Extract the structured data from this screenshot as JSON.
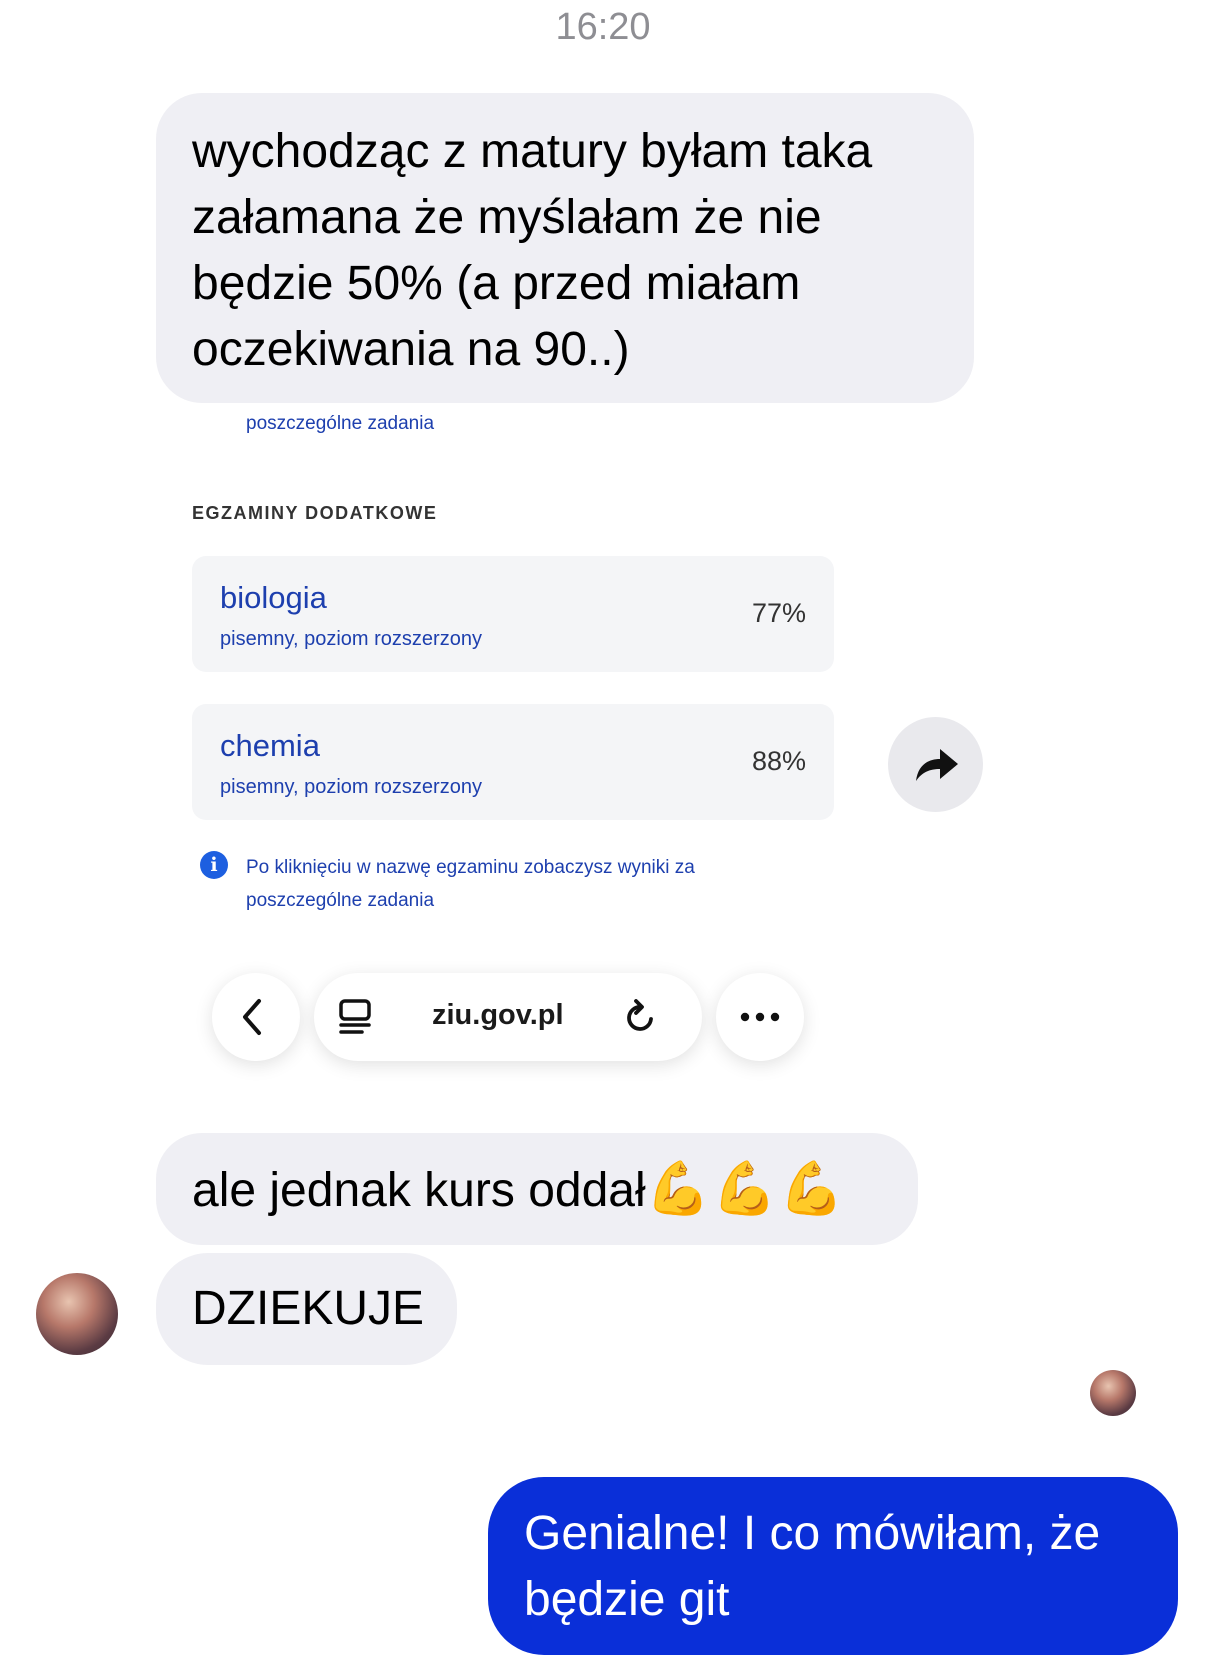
{
  "header": {
    "time": "16:20"
  },
  "messages": {
    "m1": "wychodząc z matury byłam taka załamana że myślałam że nie będzie 50% (a przed miałam oczekiwania na 90..)",
    "m2_text": "ale jednak kurs oddał",
    "m2_emoji": "💪💪💪",
    "m3": "DZIEKUJE",
    "m4": "Genialne! I co mówiłam, że będzie git"
  },
  "screenshot": {
    "top_note": "poszczególne zadania",
    "section_title": "EGZAMINY DODATKOWE",
    "exams": [
      {
        "name": "biologia",
        "detail": "pisemny, poziom rozszerzony",
        "score": "77%"
      },
      {
        "name": "chemia",
        "detail": "pisemny, poziom rozszerzony",
        "score": "88%"
      }
    ],
    "info_icon": "i",
    "info_text": "Po kliknięciu w nazwę egzaminu zobaczysz wyniki za poszczególne zadania",
    "url": "ziu.gov.pl"
  },
  "colors": {
    "incoming_bubble": "#efeff4",
    "outgoing_bubble": "#0a2fd8",
    "link_blue": "#1d3fae"
  }
}
